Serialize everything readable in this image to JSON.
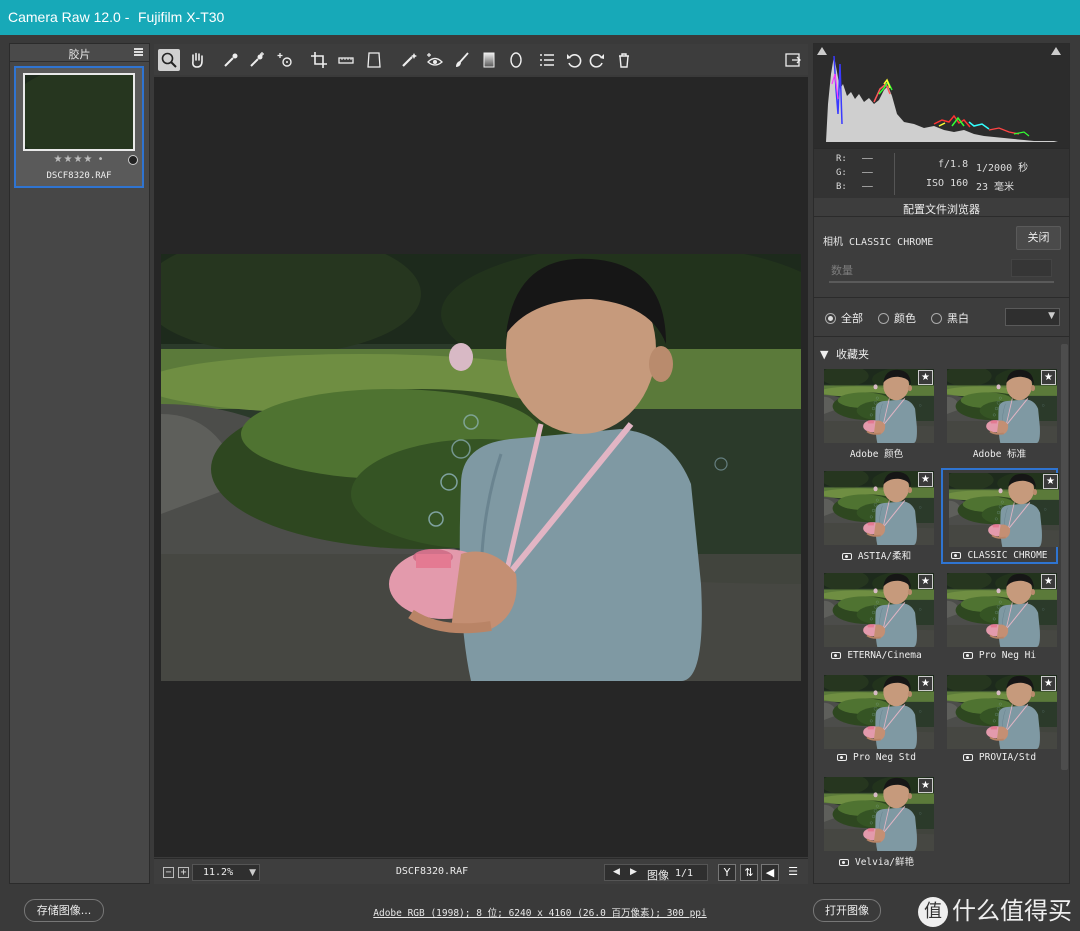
{
  "window": {
    "app_title": "Camera Raw 12.0 -",
    "camera_title": "Fujifilm X-T30"
  },
  "filmstrip": {
    "title": "胶片",
    "rating": "★★★★ •",
    "filename": "DSCF8320.RAF"
  },
  "toolbar": {
    "tools": [
      "zoom-icon",
      "hand-icon",
      "white-balance-icon",
      "color-sampler-icon",
      "targeted-adjustment-icon",
      "crop-icon",
      "straighten-icon",
      "transform-icon",
      "spot-removal-icon",
      "red-eye-icon",
      "adjustment-brush-icon",
      "graduated-filter-icon",
      "radial-filter-icon",
      "preferences-icon",
      "rotate-ccw-icon",
      "rotate-cw-icon",
      "trash-icon",
      "fullscreen-icon"
    ]
  },
  "canvas_bar": {
    "zoom_minus": "−",
    "zoom_plus": "+",
    "zoom_value": "11.2%",
    "filename": "DSCF8320.RAF",
    "image_label": "图像",
    "image_count": "1/1"
  },
  "histogram": {
    "r_label": "R:",
    "g_label": "G:",
    "b_label": "B:",
    "r_value": "——",
    "g_value": "——",
    "b_value": "——",
    "aperture": "f/1.8",
    "shutter": "1/2000 秒",
    "iso": "ISO 160",
    "focal_length": "23 毫米"
  },
  "profile_browser": {
    "title": "配置文件浏览器",
    "current_profile": "相机 CLASSIC CHROME",
    "close_label": "关闭",
    "amount_label": "数量",
    "filters": [
      "全部",
      "颜色",
      "黑白"
    ],
    "selected_filter": 0,
    "favorites_label": "收藏夹",
    "profiles": [
      {
        "label": "Adobe 颜色",
        "camera": false,
        "selected": false
      },
      {
        "label": "Adobe 标准",
        "camera": false,
        "selected": false
      },
      {
        "label": "ASTIA/柔和",
        "camera": true,
        "selected": false
      },
      {
        "label": "CLASSIC CHROME",
        "camera": true,
        "selected": true
      },
      {
        "label": "ETERNA/Cinema",
        "camera": true,
        "selected": false
      },
      {
        "label": "Pro Neg Hi",
        "camera": true,
        "selected": false
      },
      {
        "label": "Pro Neg Std",
        "camera": true,
        "selected": false
      },
      {
        "label": "PROVIA/Std",
        "camera": true,
        "selected": false
      },
      {
        "label": "Velvia/鲜艳",
        "camera": true,
        "selected": false
      }
    ]
  },
  "statusbar": {
    "save_label": "存储图像...",
    "workflow": "Adobe RGB (1998); 8 位; 6240 x 4160 (26.0 百万像素); 300 ppi",
    "open_label": "打开图像",
    "watermark": "什么值得买"
  },
  "colors": {
    "titlebar": "#17a9b8",
    "selection": "#2f74d1"
  }
}
